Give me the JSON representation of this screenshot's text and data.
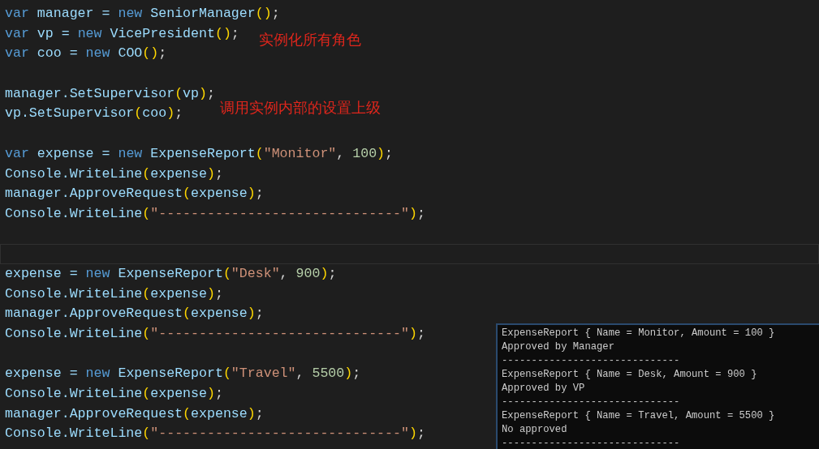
{
  "editor": {
    "lines": [
      {
        "kind": "code",
        "tokens": [
          {
            "kind": "keyword",
            "text": "var"
          },
          {
            "kind": "plain",
            "text": " manager = "
          },
          {
            "kind": "keyword",
            "text": "new"
          },
          {
            "kind": "plain",
            "text": " SeniorManager"
          },
          {
            "kind": "paren",
            "text": "()"
          },
          {
            "kind": "punct",
            "text": ";"
          }
        ]
      },
      {
        "kind": "code",
        "tokens": [
          {
            "kind": "keyword",
            "text": "var"
          },
          {
            "kind": "plain",
            "text": " vp = "
          },
          {
            "kind": "keyword",
            "text": "new"
          },
          {
            "kind": "plain",
            "text": " VicePresident"
          },
          {
            "kind": "paren",
            "text": "()"
          },
          {
            "kind": "punct",
            "text": ";"
          }
        ]
      },
      {
        "kind": "code",
        "tokens": [
          {
            "kind": "keyword",
            "text": "var"
          },
          {
            "kind": "plain",
            "text": " coo = "
          },
          {
            "kind": "keyword",
            "text": "new"
          },
          {
            "kind": "plain",
            "text": " COO"
          },
          {
            "kind": "paren",
            "text": "()"
          },
          {
            "kind": "punct",
            "text": ";"
          }
        ]
      },
      {
        "kind": "blank"
      },
      {
        "kind": "code",
        "tokens": [
          {
            "kind": "plain",
            "text": "manager.SetSupervisor"
          },
          {
            "kind": "paren",
            "text": "("
          },
          {
            "kind": "plain",
            "text": "vp"
          },
          {
            "kind": "paren",
            "text": ")"
          },
          {
            "kind": "punct",
            "text": ";"
          }
        ]
      },
      {
        "kind": "code",
        "tokens": [
          {
            "kind": "plain",
            "text": "vp.SetSupervisor"
          },
          {
            "kind": "paren",
            "text": "("
          },
          {
            "kind": "plain",
            "text": "coo"
          },
          {
            "kind": "paren",
            "text": ")"
          },
          {
            "kind": "punct",
            "text": ";"
          }
        ]
      },
      {
        "kind": "blank"
      },
      {
        "kind": "code",
        "tokens": [
          {
            "kind": "keyword",
            "text": "var"
          },
          {
            "kind": "plain",
            "text": " expense = "
          },
          {
            "kind": "keyword",
            "text": "new"
          },
          {
            "kind": "plain",
            "text": " ExpenseReport"
          },
          {
            "kind": "paren",
            "text": "("
          },
          {
            "kind": "string",
            "text": "\"Monitor\""
          },
          {
            "kind": "punct",
            "text": ", "
          },
          {
            "kind": "number",
            "text": "100"
          },
          {
            "kind": "paren",
            "text": ")"
          },
          {
            "kind": "punct",
            "text": ";"
          }
        ]
      },
      {
        "kind": "code",
        "tokens": [
          {
            "kind": "plain",
            "text": "Console.WriteLine"
          },
          {
            "kind": "paren",
            "text": "("
          },
          {
            "kind": "plain",
            "text": "expense"
          },
          {
            "kind": "paren",
            "text": ")"
          },
          {
            "kind": "punct",
            "text": ";"
          }
        ]
      },
      {
        "kind": "code",
        "tokens": [
          {
            "kind": "plain",
            "text": "manager.ApproveRequest"
          },
          {
            "kind": "paren",
            "text": "("
          },
          {
            "kind": "plain",
            "text": "expense"
          },
          {
            "kind": "paren",
            "text": ")"
          },
          {
            "kind": "punct",
            "text": ";"
          }
        ]
      },
      {
        "kind": "code",
        "tokens": [
          {
            "kind": "plain",
            "text": "Console.WriteLine"
          },
          {
            "kind": "paren",
            "text": "("
          },
          {
            "kind": "string",
            "text": "\"------------------------------\""
          },
          {
            "kind": "paren",
            "text": ")"
          },
          {
            "kind": "punct",
            "text": ";"
          }
        ]
      },
      {
        "kind": "blank"
      },
      {
        "kind": "current"
      },
      {
        "kind": "code",
        "tokens": [
          {
            "kind": "plain",
            "text": "expense = "
          },
          {
            "kind": "keyword",
            "text": "new"
          },
          {
            "kind": "plain",
            "text": " ExpenseReport"
          },
          {
            "kind": "paren",
            "text": "("
          },
          {
            "kind": "string",
            "text": "\"Desk\""
          },
          {
            "kind": "punct",
            "text": ", "
          },
          {
            "kind": "number",
            "text": "900"
          },
          {
            "kind": "paren",
            "text": ")"
          },
          {
            "kind": "punct",
            "text": ";"
          }
        ]
      },
      {
        "kind": "code",
        "tokens": [
          {
            "kind": "plain",
            "text": "Console.WriteLine"
          },
          {
            "kind": "paren",
            "text": "("
          },
          {
            "kind": "plain",
            "text": "expense"
          },
          {
            "kind": "paren",
            "text": ")"
          },
          {
            "kind": "punct",
            "text": ";"
          }
        ]
      },
      {
        "kind": "code",
        "tokens": [
          {
            "kind": "plain",
            "text": "manager.ApproveRequest"
          },
          {
            "kind": "paren",
            "text": "("
          },
          {
            "kind": "plain",
            "text": "expense"
          },
          {
            "kind": "paren",
            "text": ")"
          },
          {
            "kind": "punct",
            "text": ";"
          }
        ]
      },
      {
        "kind": "code",
        "tokens": [
          {
            "kind": "plain",
            "text": "Console.WriteLine"
          },
          {
            "kind": "paren",
            "text": "("
          },
          {
            "kind": "string",
            "text": "\"------------------------------\""
          },
          {
            "kind": "paren",
            "text": ")"
          },
          {
            "kind": "punct",
            "text": ";"
          }
        ]
      },
      {
        "kind": "blank"
      },
      {
        "kind": "code",
        "tokens": [
          {
            "kind": "plain",
            "text": "expense = "
          },
          {
            "kind": "keyword",
            "text": "new"
          },
          {
            "kind": "plain",
            "text": " ExpenseReport"
          },
          {
            "kind": "paren",
            "text": "("
          },
          {
            "kind": "string",
            "text": "\"Travel\""
          },
          {
            "kind": "punct",
            "text": ", "
          },
          {
            "kind": "number",
            "text": "5500"
          },
          {
            "kind": "paren",
            "text": ")"
          },
          {
            "kind": "punct",
            "text": ";"
          }
        ]
      },
      {
        "kind": "code",
        "tokens": [
          {
            "kind": "plain",
            "text": "Console.WriteLine"
          },
          {
            "kind": "paren",
            "text": "("
          },
          {
            "kind": "plain",
            "text": "expense"
          },
          {
            "kind": "paren",
            "text": ")"
          },
          {
            "kind": "punct",
            "text": ";"
          }
        ]
      },
      {
        "kind": "code",
        "tokens": [
          {
            "kind": "plain",
            "text": "manager.ApproveRequest"
          },
          {
            "kind": "paren",
            "text": "("
          },
          {
            "kind": "plain",
            "text": "expense"
          },
          {
            "kind": "paren",
            "text": ")"
          },
          {
            "kind": "punct",
            "text": ";"
          }
        ]
      },
      {
        "kind": "code",
        "tokens": [
          {
            "kind": "plain",
            "text": "Console.WriteLine"
          },
          {
            "kind": "paren",
            "text": "("
          },
          {
            "kind": "string",
            "text": "\"------------------------------\""
          },
          {
            "kind": "paren",
            "text": ")"
          },
          {
            "kind": "punct",
            "text": ";"
          }
        ]
      }
    ]
  },
  "annotations": [
    "实例化所有角色",
    "调用实例内部的设置上级"
  ],
  "console": {
    "lines": [
      "ExpenseReport { Name = Monitor, Amount = 100 }",
      "Approved by Manager",
      "------------------------------",
      "ExpenseReport { Name = Desk, Amount = 900 }",
      "Approved by VP",
      "------------------------------",
      "ExpenseReport { Name = Travel, Amount = 5500 }",
      "No approved",
      "------------------------------"
    ]
  }
}
